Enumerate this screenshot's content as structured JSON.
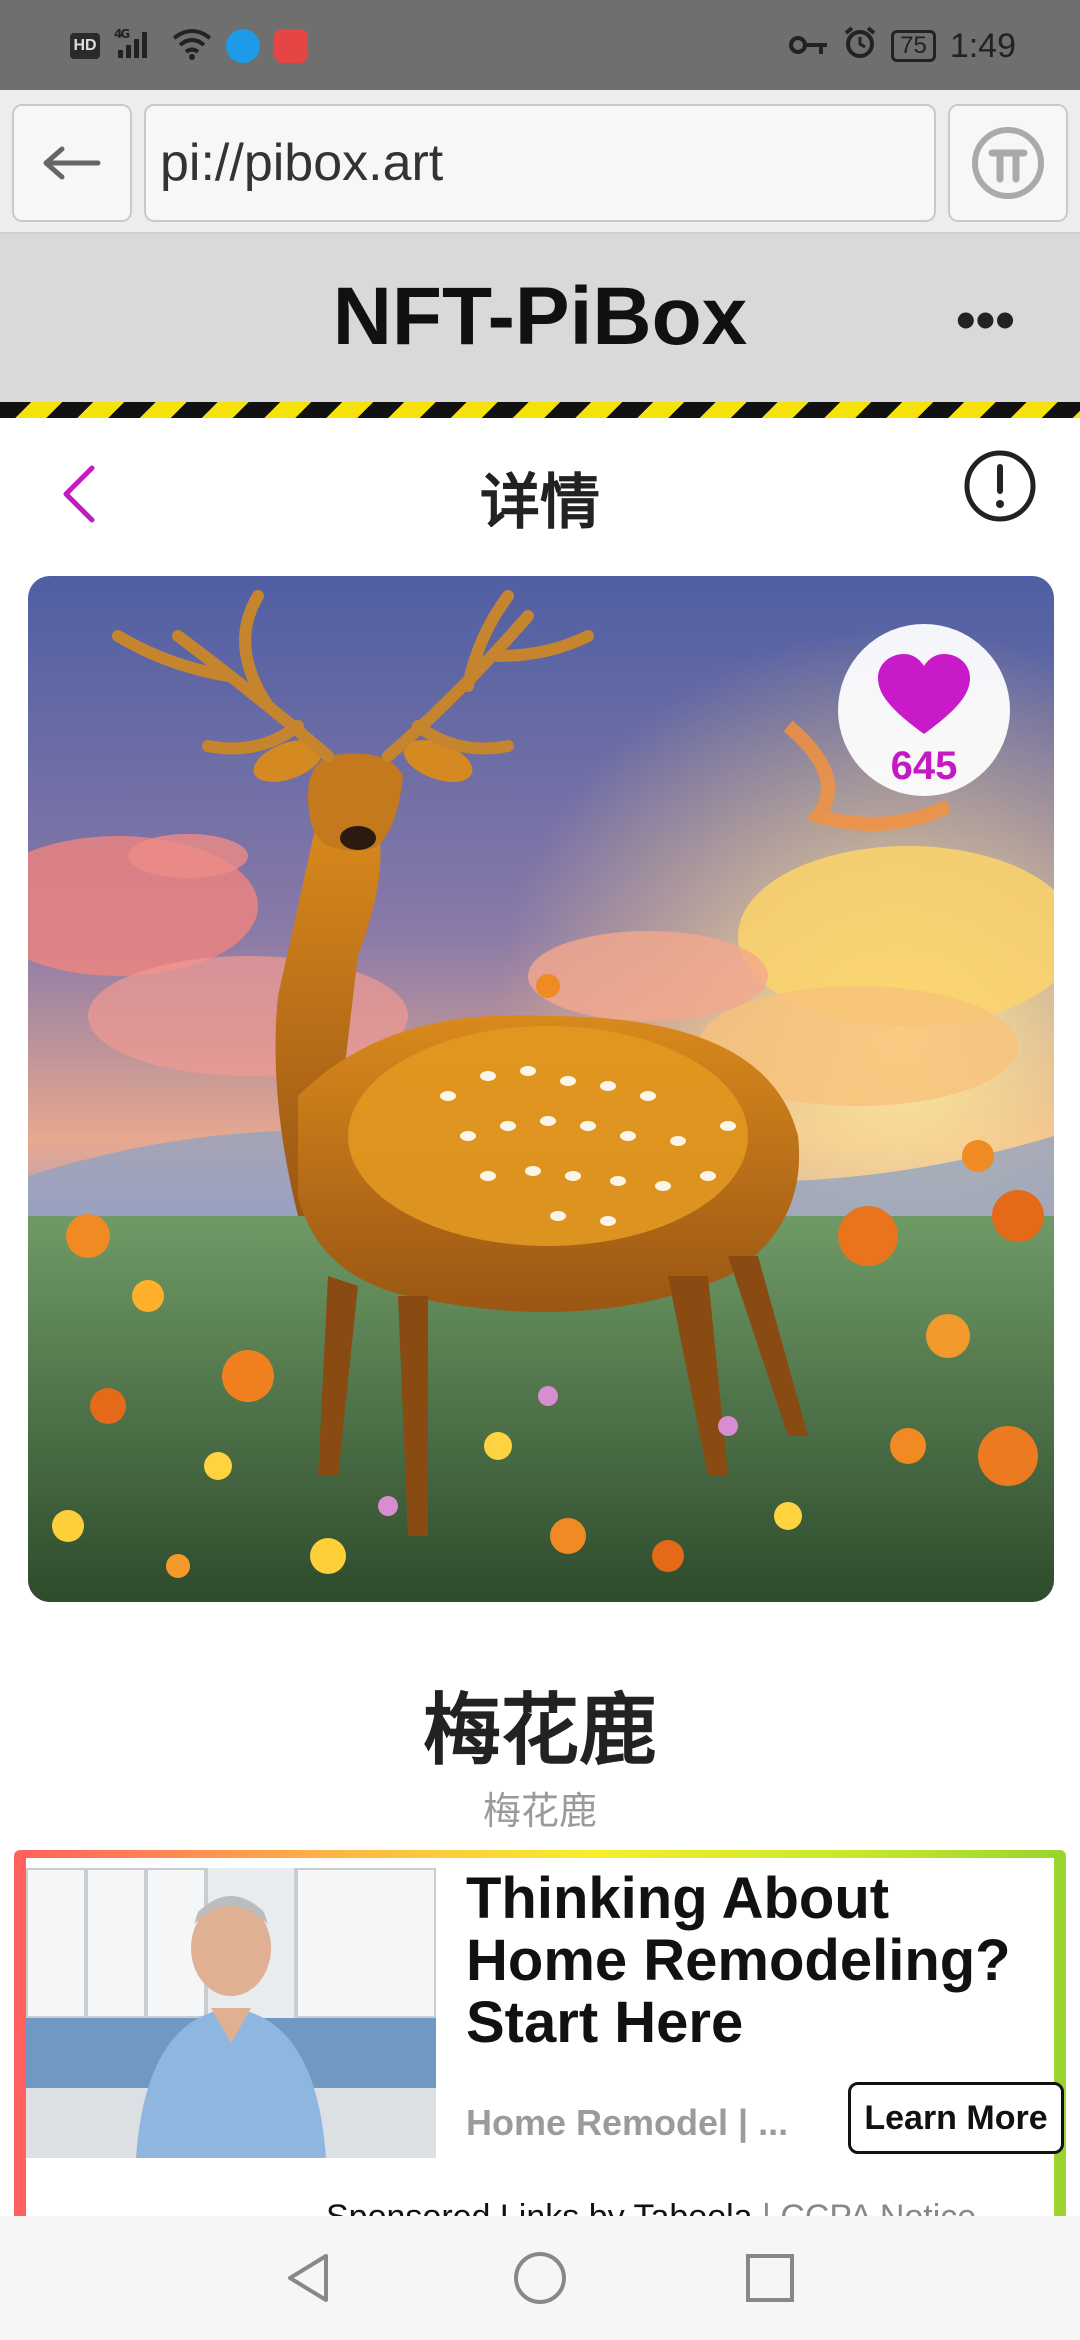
{
  "status_bar": {
    "left_icons": [
      "hd-icon",
      "signal-4g-icon",
      "wifi-icon",
      "app-notification-icon",
      "huawei-store-icon"
    ],
    "network": "4G",
    "battery": "75",
    "time": "1:49"
  },
  "browser": {
    "url": "pi://pibox.art"
  },
  "site": {
    "title": "NFT-PiBox",
    "more_label": "•••"
  },
  "detail": {
    "page_title": "详情"
  },
  "nft": {
    "likes": "645",
    "name": "梅花鹿",
    "subtitle": "梅花鹿"
  },
  "ad": {
    "headline": "Thinking About Home Remodeling? Start Here",
    "source": "Home Remodel | ...",
    "cta": "Learn More",
    "sponsor": "Sponsored Links by Taboola",
    "separator": "|",
    "ccpa": "CCPA Notice"
  },
  "colors": {
    "accent": "#c41ac4",
    "hazard_yellow": "#f5e20a",
    "header_bg": "#d9d9d9"
  }
}
